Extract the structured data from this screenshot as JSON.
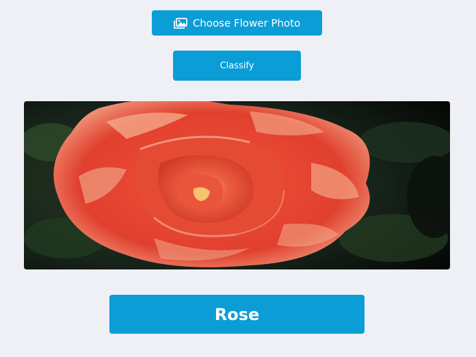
{
  "choose_button": {
    "label": "Choose Flower Photo",
    "icon": "image-icon"
  },
  "classify_button": {
    "label": "Classify"
  },
  "photo": {
    "subject": "red rose"
  },
  "result": {
    "label": "Rose"
  },
  "colors": {
    "accent": "#0b9dd6",
    "background": "#eff0f6"
  }
}
